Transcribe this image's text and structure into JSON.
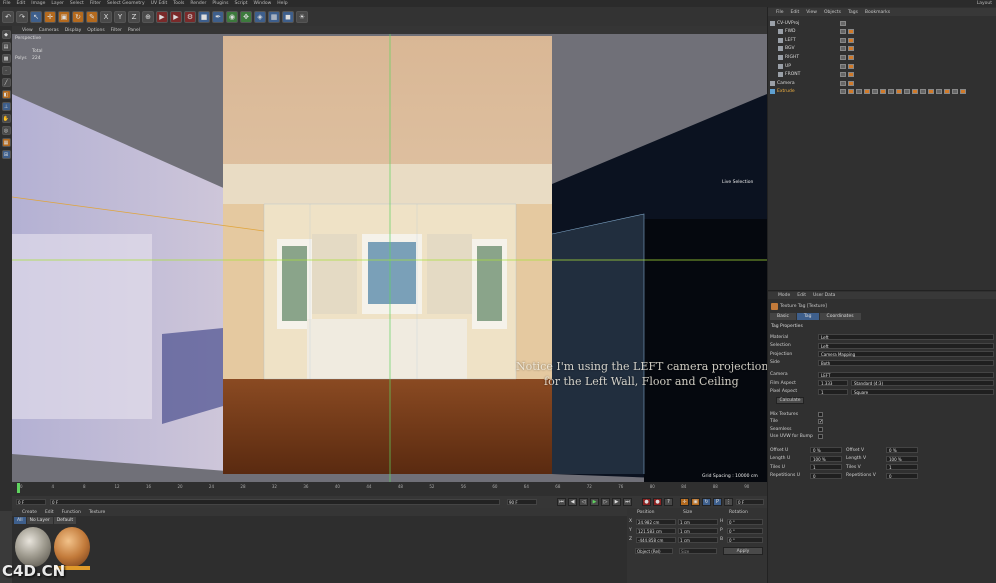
{
  "app": {
    "menu": [
      "File",
      "Edit",
      "Image",
      "Layer",
      "Select",
      "Filter",
      "Select Geometry",
      "UV Edit",
      "Tools",
      "Render",
      "Plugins",
      "Script",
      "Window",
      "Help"
    ],
    "layout_label": "Layout"
  },
  "viewport": {
    "menu": [
      "View",
      "Cameras",
      "Display",
      "Options",
      "Filter",
      "Panel"
    ],
    "title": "Perspective",
    "stats_header": "Total",
    "stats_label": "Polys",
    "stats_value": "224",
    "live_selection": "Live Selection",
    "grid_spacing": "Grid Spacing : 10000 cm",
    "subtitle_line1": "Notice I'm using the LEFT camera projection",
    "subtitle_line2": "for the Left Wall, Floor and Ceiling"
  },
  "timeline": {
    "ticks": [
      "0",
      "4",
      "8",
      "12",
      "16",
      "20",
      "24",
      "28",
      "32",
      "36",
      "40",
      "44",
      "48",
      "52",
      "56",
      "60",
      "64",
      "68",
      "72",
      "76",
      "80",
      "84",
      "88",
      "90"
    ],
    "start_field": "0 F",
    "current_field": "0 F",
    "end_field": "90 F",
    "fps_field": "0 F"
  },
  "materials": {
    "menu": [
      "Create",
      "Edit",
      "Function",
      "Texture"
    ],
    "tabs": [
      "All",
      "No Layer",
      "Default"
    ]
  },
  "coordinates": {
    "headers": [
      "Position",
      "Size",
      "Rotation"
    ],
    "rows": [
      {
        "axis": "X",
        "pos": "24.982 cm",
        "size": "1 cm",
        "rot_axis": "H",
        "rot": "0 °"
      },
      {
        "axis": "Y",
        "pos": "121.583 cm",
        "size": "1 cm",
        "rot_axis": "P",
        "rot": "0 °"
      },
      {
        "axis": "Z",
        "pos": "-444.858 cm",
        "size": "1 cm",
        "rot_axis": "B",
        "rot": "0 °"
      }
    ],
    "mode_select": "Object (Rel)",
    "size_select": "Size",
    "apply_label": "Apply"
  },
  "object_manager": {
    "menu": [
      "File",
      "Edit",
      "View",
      "Objects",
      "Tags",
      "Bookmarks"
    ],
    "objects": [
      {
        "name": "CV-UVProj",
        "indent": 0,
        "tags": 1
      },
      {
        "name": "FWD",
        "indent": 1,
        "tags": 2
      },
      {
        "name": "LEFT",
        "indent": 1,
        "tags": 2
      },
      {
        "name": "BGV",
        "indent": 1,
        "tags": 2
      },
      {
        "name": "RIGHT",
        "indent": 1,
        "tags": 2
      },
      {
        "name": "UP",
        "indent": 1,
        "tags": 2
      },
      {
        "name": "FRONT",
        "indent": 1,
        "tags": 2
      },
      {
        "name": "Camera",
        "indent": 0,
        "tags": 2
      },
      {
        "name": "Extrude",
        "indent": 0,
        "tags": 16
      }
    ]
  },
  "attributes": {
    "menu": [
      "Mode",
      "Edit",
      "User Data"
    ],
    "header": "Texture Tag [Texture]",
    "tabs": [
      "Basic",
      "Tag",
      "Coordinates"
    ],
    "section": "Tag Properties",
    "rows": [
      {
        "label": "Material",
        "value": "Left"
      },
      {
        "label": "Selection",
        "value": "Left"
      },
      {
        "label": "Projection",
        "value": "Camera Mapping"
      },
      {
        "label": "Side",
        "value": "Both"
      },
      {
        "label": "Camera",
        "value": "LEFT"
      },
      {
        "label": "Film Aspect",
        "value": "1.333",
        "extra": "Standard (4:3)"
      },
      {
        "label": "Pixel Aspect",
        "value": "1",
        "extra": "Square"
      }
    ],
    "calculate": "Calculate",
    "checks": [
      {
        "label": "Mix Textures",
        "checked": false
      },
      {
        "label": "Tile",
        "checked": true
      },
      {
        "label": "Seamless",
        "checked": false
      },
      {
        "label": "Use UVW for Bump",
        "checked": false
      }
    ],
    "pairs": [
      {
        "l1": "Offset U",
        "v1": "0 %",
        "l2": "Offset V",
        "v2": "0 %"
      },
      {
        "l1": "Length U",
        "v1": "100 %",
        "l2": "Length V",
        "v2": "100 %"
      },
      {
        "l1": "Tiles U",
        "v1": "1",
        "l2": "Tiles V",
        "v2": "1"
      },
      {
        "l1": "Repetitions U",
        "v1": "0",
        "l2": "Repetitions V",
        "v2": "0"
      }
    ]
  },
  "watermark": "C4D.CN"
}
